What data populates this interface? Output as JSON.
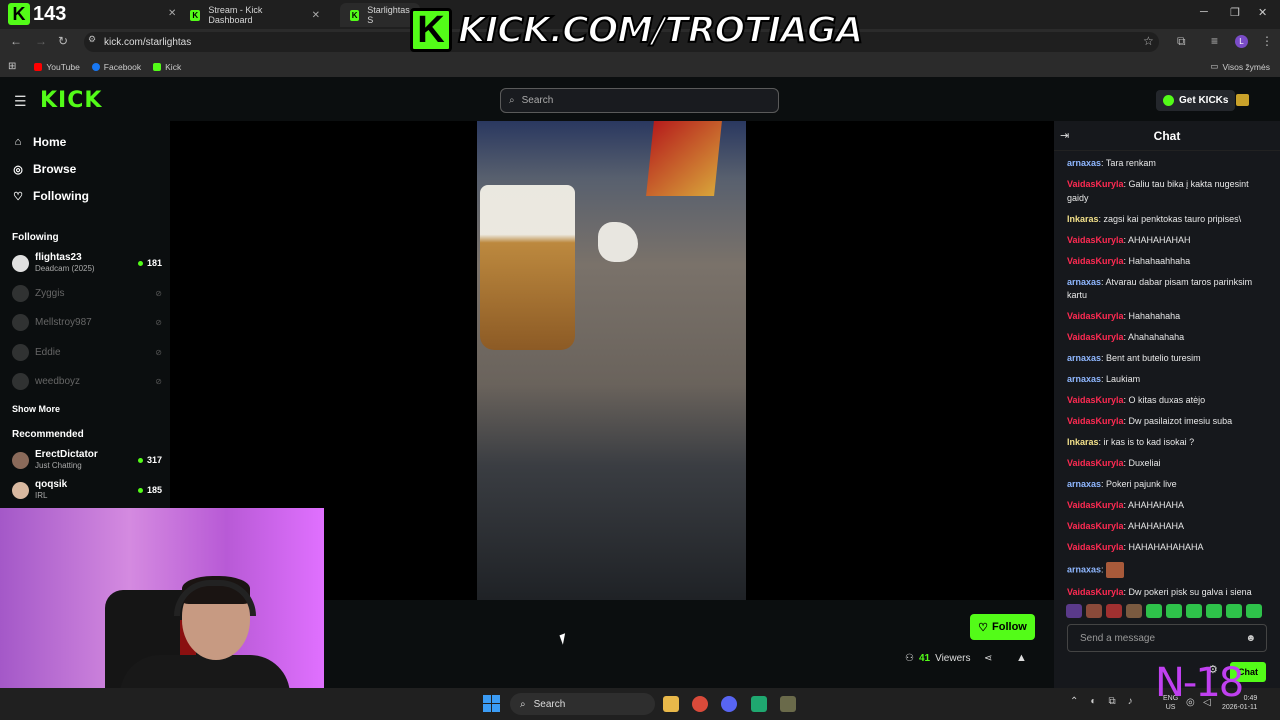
{
  "browser": {
    "counter": {
      "logo": "K",
      "value": "143"
    },
    "tabs": [
      {
        "title": "Stream - Kick Dashboard"
      },
      {
        "title": "Starlightas S"
      }
    ],
    "url": "kick.com/starlightas",
    "bookmarks": [
      {
        "label": "YouTube",
        "color": "#ff0000"
      },
      {
        "label": "Facebook",
        "color": "#1877f2"
      },
      {
        "label": "Kick",
        "color": "#53fc18"
      }
    ],
    "bookmarks_folder": "Visos žymės"
  },
  "overlay": {
    "logo": "K",
    "banner_text": "KICK.COM/TROTIAGA",
    "n18": "N-18"
  },
  "header": {
    "logo": "KICK",
    "search_placeholder": "Search",
    "get_kicks": "Get KICKs"
  },
  "sidebar": {
    "nav": [
      {
        "label": "Home",
        "icon": "home-icon"
      },
      {
        "label": "Browse",
        "icon": "compass-icon"
      },
      {
        "label": "Following",
        "icon": "heart-icon"
      }
    ],
    "following_title": "Following",
    "following": [
      {
        "name": "flightas23",
        "sub": "Deadcam (2025)",
        "viewers": "181",
        "live": true
      },
      {
        "name": "Zyggis",
        "live": false
      },
      {
        "name": "Mellstroy987",
        "live": false
      },
      {
        "name": "Eddie",
        "live": false
      },
      {
        "name": "weedboyz",
        "live": false
      }
    ],
    "show_more": "Show More",
    "recommended_title": "Recommended",
    "recommended": [
      {
        "name": "ErectDictator",
        "sub": "Just Chatting",
        "viewers": "317"
      },
      {
        "name": "qoqsik",
        "sub": "IRL",
        "viewers": "185"
      }
    ]
  },
  "stream": {
    "follow_label": "Follow",
    "viewers_count": "41",
    "viewers_label": "Viewers"
  },
  "chat": {
    "title": "Chat",
    "messages": [
      {
        "user": "arnaxas",
        "color": "#8fb7ff",
        "text": "Tara renkam"
      },
      {
        "user": "VaidasKuryla",
        "color": "#ff2a52",
        "text": "Galiu tau bika į kakta nugesint gaidy"
      },
      {
        "user": "Inkaras",
        "color": "#f2e08a",
        "text": "zagsi kai penktokas tauro pripises\\"
      },
      {
        "user": "VaidasKuryla",
        "color": "#ff2a52",
        "text": "AHAHAHAHAH"
      },
      {
        "user": "VaidasKuryla",
        "color": "#ff2a52",
        "text": "Hahahaahhaha"
      },
      {
        "user": "arnaxas",
        "color": "#8fb7ff",
        "text": "Atvarau dabar pisam taros parinksim kartu"
      },
      {
        "user": "VaidasKuryla",
        "color": "#ff2a52",
        "text": "Hahahahaha"
      },
      {
        "user": "VaidasKuryla",
        "color": "#ff2a52",
        "text": "Ahahahahaha"
      },
      {
        "user": "arnaxas",
        "color": "#8fb7ff",
        "text": "Bent ant butelio turesim"
      },
      {
        "user": "arnaxas",
        "color": "#8fb7ff",
        "text": "Laukiam"
      },
      {
        "user": "VaidasKuryla",
        "color": "#ff2a52",
        "text": "O kitas duxas atėjo"
      },
      {
        "user": "VaidasKuryla",
        "color": "#ff2a52",
        "text": "Dw pasilaizot imesiu suba"
      },
      {
        "user": "Inkaras",
        "color": "#f2e08a",
        "text": "ir kas is to kad isokai ?"
      },
      {
        "user": "VaidasKuryla",
        "color": "#ff2a52",
        "text": "Duxeliai"
      },
      {
        "user": "arnaxas",
        "color": "#8fb7ff",
        "text": "Pokeri pajunk live"
      },
      {
        "user": "VaidasKuryla",
        "color": "#ff2a52",
        "text": "AHAHAHAHA"
      },
      {
        "user": "VaidasKuryla",
        "color": "#ff2a52",
        "text": "AHAHAHAHA"
      },
      {
        "user": "VaidasKuryla",
        "color": "#ff2a52",
        "text": "HAHAHAHAHAHA"
      },
      {
        "user": "arnaxas",
        "color": "#8fb7ff",
        "text": "",
        "emote": true
      },
      {
        "user": "VaidasKuryla",
        "color": "#ff2a52",
        "text": "Dw pokeri pisk su galva i siena"
      }
    ],
    "input_placeholder": "Send a message",
    "chat_button": "Chat"
  },
  "taskbar": {
    "search": "Search",
    "lang": "ENG",
    "region": "US",
    "time": "0:49",
    "date": "2026-01-11"
  }
}
